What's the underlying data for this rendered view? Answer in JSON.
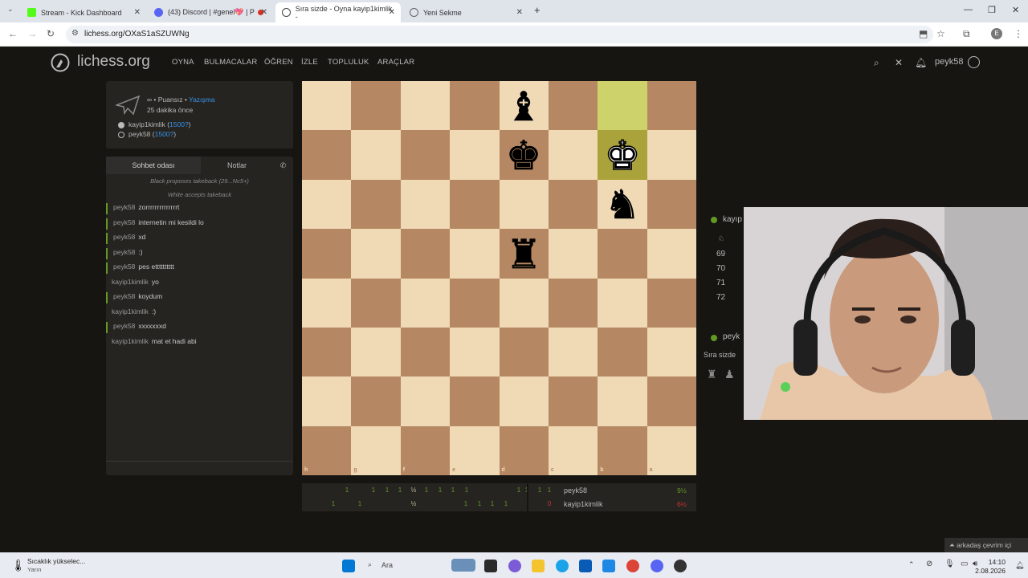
{
  "browser": {
    "tabs": [
      {
        "title": "Stream - Kick Dashboard",
        "color": "#53fc18"
      },
      {
        "title": "(43) Discord | #genel💖 | P",
        "color": "#5865f2"
      },
      {
        "title": "Sıra sizde - Oyna kayip1kimlik -",
        "color": "#444"
      },
      {
        "title": "Yeni Sekme",
        "color": "#666"
      }
    ],
    "new_tab": "+",
    "url": "lichess.org/OXaS1aSZUWNg",
    "profile_letter": "E"
  },
  "lichess": {
    "logo": "lichess.org",
    "nav": [
      "OYNA",
      "BULMACALAR",
      "ÖĞREN",
      "İZLE",
      "TOPLULUK",
      "ARAÇLAR"
    ],
    "user": "peyk58"
  },
  "game_info": {
    "mode": "∞ • Puansız •",
    "variant": "Yazışma",
    "ago": "25 dakika önce",
    "white_player": "kayip1kimlik",
    "white_rating": "1500?",
    "black_player": "peyk58",
    "black_rating": "1500?"
  },
  "chat": {
    "tab_room": "Sohbet odası",
    "tab_notes": "Notlar",
    "system": [
      "Black proposes takeback (29...Nc5+)",
      "White accepts takeback"
    ],
    "messages": [
      {
        "user": "peyk58",
        "text": "zorrrrrrrrrrrrrrt",
        "self": true
      },
      {
        "user": "peyk58",
        "text": "internetin mi kesildi lo",
        "self": true
      },
      {
        "user": "peyk58",
        "text": "xd",
        "self": true
      },
      {
        "user": "peyk58",
        "text": ":)",
        "self": true
      },
      {
        "user": "peyk58",
        "text": "pes etttttttttt",
        "self": true
      },
      {
        "user": "kayip1kimlik",
        "text": "yo",
        "self": false
      },
      {
        "user": "peyk58",
        "text": "koydum",
        "self": true
      },
      {
        "user": "kayip1kimlik",
        "text": ":)",
        "self": false
      },
      {
        "user": "peyk58",
        "text": "xxxxxxxd",
        "self": true
      },
      {
        "user": "kayip1kimlik",
        "text": "mat et hadi abi",
        "self": false
      }
    ]
  },
  "board": {
    "orientation": "black",
    "ranks": [
      "1",
      "2",
      "3",
      "4",
      "5",
      "6",
      "7",
      "8"
    ],
    "files": [
      "h",
      "g",
      "f",
      "e",
      "d",
      "c",
      "b",
      "a"
    ],
    "pieces": [
      {
        "square": "d1",
        "piece": "black-bishop"
      },
      {
        "square": "d2",
        "piece": "black-king"
      },
      {
        "square": "b2",
        "piece": "white-king"
      },
      {
        "square": "b3",
        "piece": "black-knight"
      },
      {
        "square": "d4",
        "piece": "black-rook"
      }
    ],
    "last_move": [
      "b1",
      "b2"
    ]
  },
  "scoreboard": {
    "row1_scores": [
      "1",
      "1",
      "1",
      "1",
      "½",
      "1",
      "1",
      "1",
      "1",
      "1",
      "1"
    ],
    "row2_scores": [
      "1",
      "1",
      "½",
      "1",
      "1",
      "1",
      "1",
      "0"
    ],
    "player1": "peyk58",
    "player1_pct": "9½",
    "player2": "kayip1kimlik",
    "player2_pct": "6½"
  },
  "side_panel": {
    "top_name": "kayıp",
    "moves": [
      "69",
      "70",
      "71",
      "72"
    ],
    "bottom_name": "peyk",
    "turn": "Sıra sizde"
  },
  "friends": "arkadaş çevrim içi",
  "taskbar": {
    "weather_title": "Sıcaklık yükselec...",
    "weather_sub": "Yarın",
    "search": "Ara",
    "time": "14:10",
    "date": "2.08.2026"
  }
}
